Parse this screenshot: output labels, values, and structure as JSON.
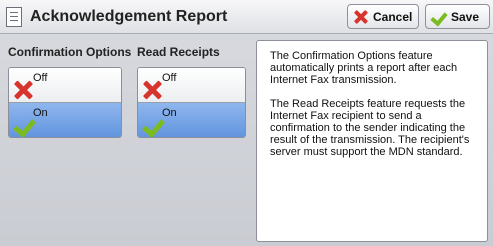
{
  "header": {
    "title": "Acknowledgement Report",
    "cancel_label": "Cancel",
    "save_label": "Save"
  },
  "confirmation": {
    "label": "Confirmation Options",
    "options": [
      {
        "label": "Off",
        "icon": "x-icon",
        "selected": false
      },
      {
        "label": "On",
        "icon": "check-icon",
        "selected": true
      }
    ]
  },
  "receipts": {
    "label": "Read Receipts",
    "options": [
      {
        "label": "Off",
        "icon": "x-icon",
        "selected": false
      },
      {
        "label": "On",
        "icon": "check-icon",
        "selected": true
      }
    ]
  },
  "description": {
    "paragraphs": [
      "The Confirmation Options feature automatically prints a report after each Internet Fax transmission.",
      "The Read Receipts feature requests the Internet Fax recipient to send a confirmation to the sender indicating the result of the transmission.  The recipient's server must support the MDN standard."
    ]
  },
  "colors": {
    "selected": "#6f9fe3",
    "cancel": "#d6342c",
    "check": "#7cbb1f"
  }
}
